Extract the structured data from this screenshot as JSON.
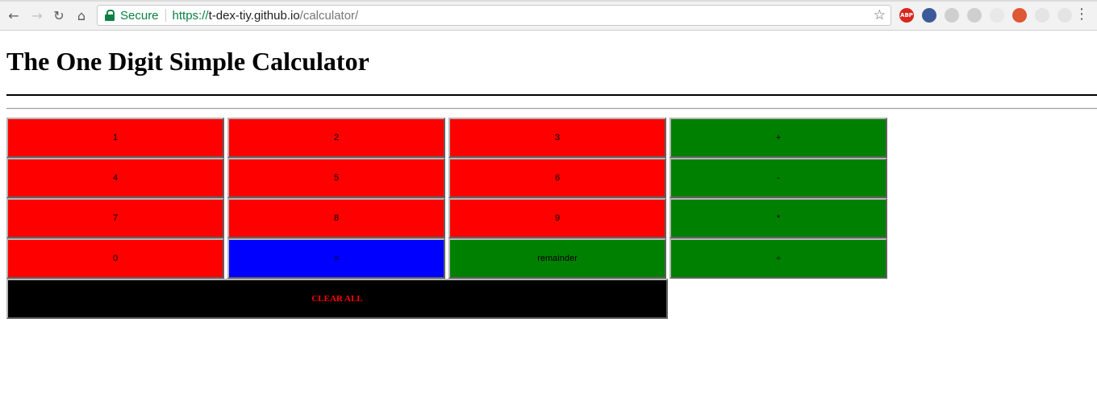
{
  "browser": {
    "secure_label": "Secure",
    "url_scheme": "https://",
    "url_host": "t-dex-tiy.github.io",
    "url_path": "/calculator/",
    "extension_abp": "ABP",
    "menu_glyph": "⋮"
  },
  "page": {
    "title": "The One Digit Simple Calculator"
  },
  "keys": {
    "k1": {
      "label": "1",
      "color": "#ff0000"
    },
    "k2": {
      "label": "2",
      "color": "#ff0000"
    },
    "k3": {
      "label": "3",
      "color": "#ff0000"
    },
    "plus": {
      "label": "+",
      "color": "#008000"
    },
    "k4": {
      "label": "4",
      "color": "#ff0000"
    },
    "k5": {
      "label": "5",
      "color": "#ff0000"
    },
    "k6": {
      "label": "6",
      "color": "#ff0000"
    },
    "minus": {
      "label": "-",
      "color": "#008000"
    },
    "k7": {
      "label": "7",
      "color": "#ff0000"
    },
    "k8": {
      "label": "8",
      "color": "#ff0000"
    },
    "k9": {
      "label": "9",
      "color": "#ff0000"
    },
    "multiply": {
      "label": "*",
      "color": "#008000"
    },
    "k0": {
      "label": "0",
      "color": "#ff0000"
    },
    "equals": {
      "label": "=",
      "color": "#0000ff"
    },
    "remainder": {
      "label": "remainder",
      "color": "#008000"
    },
    "divide": {
      "label": "÷",
      "color": "#008000"
    },
    "clear": {
      "label": "CLEAR ALL",
      "color": "#000000",
      "text_color": "#ff0000"
    }
  }
}
